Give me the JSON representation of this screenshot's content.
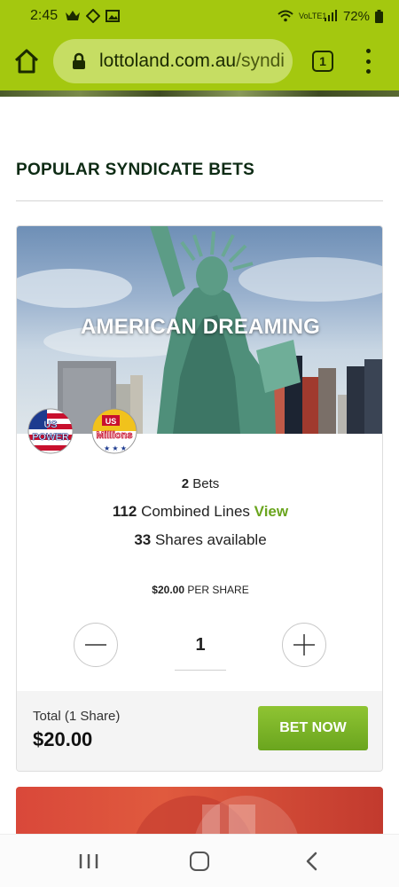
{
  "status_bar": {
    "time": "2:45",
    "network": "VoLTE1",
    "battery": "72%"
  },
  "browser": {
    "url_domain": "lottoland.com.au",
    "url_path": "/syndi",
    "tab_count": "1"
  },
  "section": {
    "title": "POPULAR SYNDICATE BETS"
  },
  "syndicate": {
    "name": "AMERICAN DREAMING",
    "logos": [
      "US POWER",
      "US Millions"
    ],
    "bets_count": "2",
    "bets_label": "Bets",
    "lines_count": "112",
    "lines_label": "Combined Lines",
    "view_link": "View",
    "shares_count": "33",
    "shares_label": "Shares available",
    "price_value": "$20.00",
    "price_label": "PER SHARE",
    "quantity": "1",
    "total_label": "Total (1 Share)",
    "total_value": "$20.00",
    "bet_button": "BET NOW"
  },
  "colors": {
    "brand": "#a4c80f",
    "accent": "#6aa51e",
    "title": "#0d2b14"
  }
}
